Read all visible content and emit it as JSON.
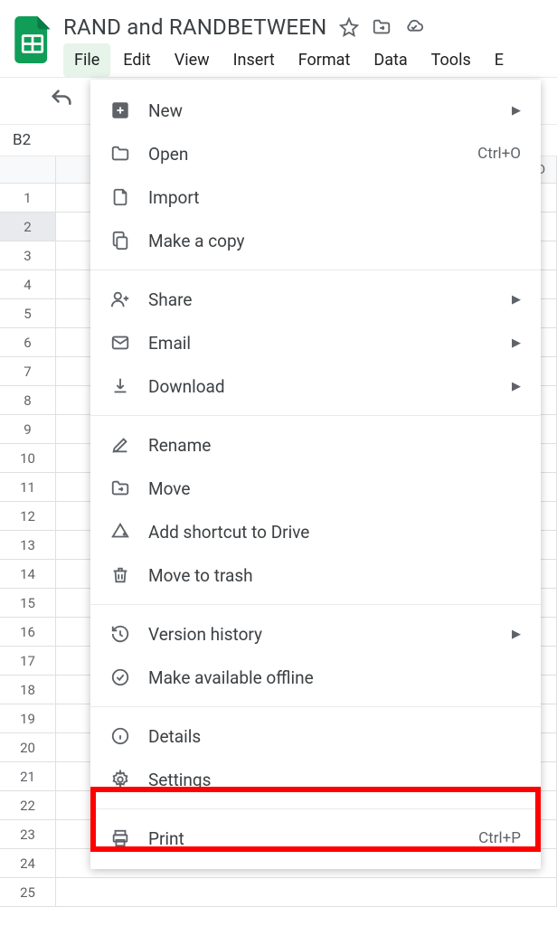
{
  "doc_title": "RAND and RANDBETWEEN",
  "menubar": [
    "File",
    "Edit",
    "View",
    "Insert",
    "Format",
    "Data",
    "Tools",
    "E"
  ],
  "namebox": "B2",
  "col_d": "D",
  "rows": [
    1,
    2,
    3,
    4,
    5,
    6,
    7,
    8,
    9,
    10,
    11,
    12,
    13,
    14,
    15,
    16,
    17,
    18,
    19,
    20,
    21,
    22,
    23,
    24,
    25
  ],
  "file_menu": {
    "new": "New",
    "open": "Open",
    "open_shortcut": "Ctrl+O",
    "import": "Import",
    "make_copy": "Make a copy",
    "share": "Share",
    "email": "Email",
    "download": "Download",
    "rename": "Rename",
    "move": "Move",
    "add_shortcut": "Add shortcut to Drive",
    "trash": "Move to trash",
    "version_history": "Version history",
    "offline": "Make available offline",
    "details": "Details",
    "settings": "Settings",
    "print": "Print",
    "print_shortcut": "Ctrl+P"
  }
}
